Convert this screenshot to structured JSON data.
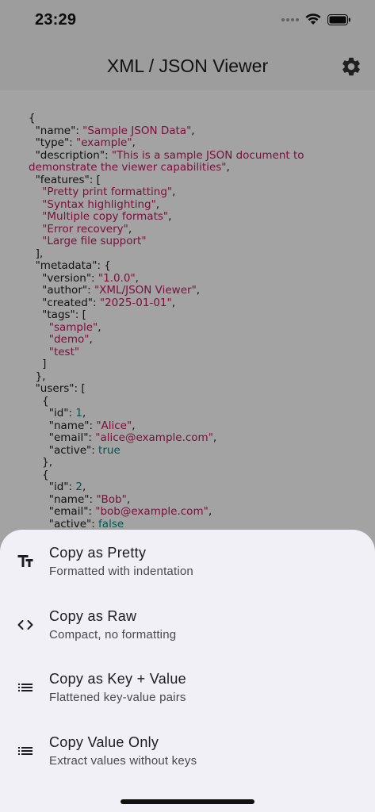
{
  "status_bar": {
    "time": "23:29"
  },
  "app_bar": {
    "title": "XML / JSON Viewer"
  },
  "json_lines": [
    [
      [
        "p",
        "{"
      ]
    ],
    [
      [
        "p",
        "  "
      ],
      [
        "k",
        "\"name\""
      ],
      [
        "p",
        ": "
      ],
      [
        "s",
        "\"Sample JSON Data\""
      ],
      [
        "p",
        ","
      ]
    ],
    [
      [
        "p",
        "  "
      ],
      [
        "k",
        "\"type\""
      ],
      [
        "p",
        ": "
      ],
      [
        "s",
        "\"example\""
      ],
      [
        "p",
        ","
      ]
    ],
    [
      [
        "p",
        "  "
      ],
      [
        "k",
        "\"description\""
      ],
      [
        "p",
        ": "
      ],
      [
        "s",
        "\"This is a sample JSON document to demonstrate the viewer capabilities\""
      ],
      [
        "p",
        ","
      ]
    ],
    [
      [
        "p",
        "  "
      ],
      [
        "k",
        "\"features\""
      ],
      [
        "p",
        ": ["
      ]
    ],
    [
      [
        "p",
        "    "
      ],
      [
        "s",
        "\"Pretty print formatting\""
      ],
      [
        "p",
        ","
      ]
    ],
    [
      [
        "p",
        "    "
      ],
      [
        "s",
        "\"Syntax highlighting\""
      ],
      [
        "p",
        ","
      ]
    ],
    [
      [
        "p",
        "    "
      ],
      [
        "s",
        "\"Multiple copy formats\""
      ],
      [
        "p",
        ","
      ]
    ],
    [
      [
        "p",
        "    "
      ],
      [
        "s",
        "\"Error recovery\""
      ],
      [
        "p",
        ","
      ]
    ],
    [
      [
        "p",
        "    "
      ],
      [
        "s",
        "\"Large file support\""
      ]
    ],
    [
      [
        "p",
        "  ],"
      ]
    ],
    [
      [
        "p",
        "  "
      ],
      [
        "k",
        "\"metadata\""
      ],
      [
        "p",
        ": {"
      ]
    ],
    [
      [
        "p",
        "    "
      ],
      [
        "k",
        "\"version\""
      ],
      [
        "p",
        ": "
      ],
      [
        "s",
        "\"1.0.0\""
      ],
      [
        "p",
        ","
      ]
    ],
    [
      [
        "p",
        "    "
      ],
      [
        "k",
        "\"author\""
      ],
      [
        "p",
        ": "
      ],
      [
        "s",
        "\"XML/JSON Viewer\""
      ],
      [
        "p",
        ","
      ]
    ],
    [
      [
        "p",
        "    "
      ],
      [
        "k",
        "\"created\""
      ],
      [
        "p",
        ": "
      ],
      [
        "s",
        "\"2025-01-01\""
      ],
      [
        "p",
        ","
      ]
    ],
    [
      [
        "p",
        "    "
      ],
      [
        "k",
        "\"tags\""
      ],
      [
        "p",
        ": ["
      ]
    ],
    [
      [
        "p",
        "      "
      ],
      [
        "s",
        "\"sample\""
      ],
      [
        "p",
        ","
      ]
    ],
    [
      [
        "p",
        "      "
      ],
      [
        "s",
        "\"demo\""
      ],
      [
        "p",
        ","
      ]
    ],
    [
      [
        "p",
        "      "
      ],
      [
        "s",
        "\"test\""
      ]
    ],
    [
      [
        "p",
        "    ]"
      ]
    ],
    [
      [
        "p",
        "  },"
      ]
    ],
    [
      [
        "p",
        "  "
      ],
      [
        "k",
        "\"users\""
      ],
      [
        "p",
        ": ["
      ]
    ],
    [
      [
        "p",
        "    {"
      ]
    ],
    [
      [
        "p",
        "      "
      ],
      [
        "k",
        "\"id\""
      ],
      [
        "p",
        ": "
      ],
      [
        "n",
        "1"
      ],
      [
        "p",
        ","
      ]
    ],
    [
      [
        "p",
        "      "
      ],
      [
        "k",
        "\"name\""
      ],
      [
        "p",
        ": "
      ],
      [
        "s",
        "\"Alice\""
      ],
      [
        "p",
        ","
      ]
    ],
    [
      [
        "p",
        "      "
      ],
      [
        "k",
        "\"email\""
      ],
      [
        "p",
        ": "
      ],
      [
        "s",
        "\"alice@example.com\""
      ],
      [
        "p",
        ","
      ]
    ],
    [
      [
        "p",
        "      "
      ],
      [
        "k",
        "\"active\""
      ],
      [
        "p",
        ": "
      ],
      [
        "b",
        "true"
      ]
    ],
    [
      [
        "p",
        "    },"
      ]
    ],
    [
      [
        "p",
        "    {"
      ]
    ],
    [
      [
        "p",
        "      "
      ],
      [
        "k",
        "\"id\""
      ],
      [
        "p",
        ": "
      ],
      [
        "n",
        "2"
      ],
      [
        "p",
        ","
      ]
    ],
    [
      [
        "p",
        "      "
      ],
      [
        "k",
        "\"name\""
      ],
      [
        "p",
        ": "
      ],
      [
        "s",
        "\"Bob\""
      ],
      [
        "p",
        ","
      ]
    ],
    [
      [
        "p",
        "      "
      ],
      [
        "k",
        "\"email\""
      ],
      [
        "p",
        ": "
      ],
      [
        "s",
        "\"bob@example.com\""
      ],
      [
        "p",
        ","
      ]
    ],
    [
      [
        "p",
        "      "
      ],
      [
        "k",
        "\"active\""
      ],
      [
        "p",
        ": "
      ],
      [
        "b",
        "false"
      ]
    ],
    [
      [
        "p",
        "    }"
      ]
    ],
    [
      [
        "p",
        "  ]"
      ]
    ],
    [
      [
        "p",
        "}"
      ]
    ]
  ],
  "sheet": {
    "options": [
      {
        "icon": "text-format-icon",
        "title": "Copy as Pretty",
        "subtitle": "Formatted with indentation"
      },
      {
        "icon": "code-icon",
        "title": "Copy as Raw",
        "subtitle": "Compact, no formatting"
      },
      {
        "icon": "list-icon",
        "title": "Copy as Key + Value",
        "subtitle": "Flattened key-value pairs"
      },
      {
        "icon": "list-icon",
        "title": "Copy Value Only",
        "subtitle": "Extract values without keys"
      }
    ]
  },
  "colors": {
    "json_string": "#c2185b",
    "json_number": "#00897b",
    "json_key": "#1a1a1a",
    "sheet_background": "#f1f0f6"
  }
}
